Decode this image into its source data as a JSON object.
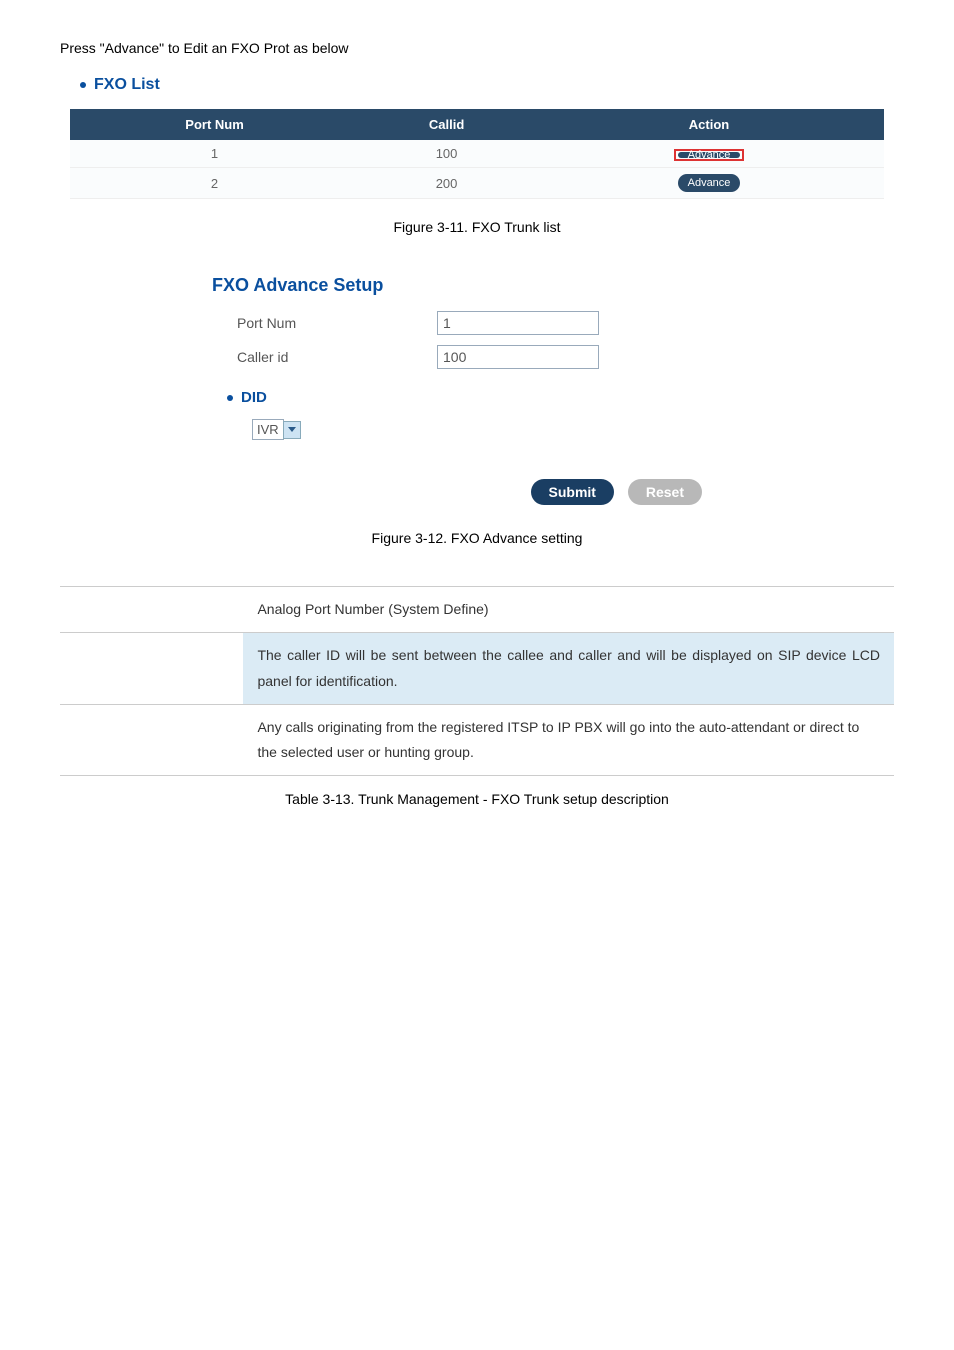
{
  "intro": "Press \"Advance\" to Edit an FXO Prot as below",
  "fxo_list": {
    "title": "FXO List",
    "headers": [
      "Port Num",
      "Callid",
      "Action"
    ],
    "rows": [
      {
        "port": "1",
        "callid": "100",
        "action": "Advance",
        "highlighted": true
      },
      {
        "port": "2",
        "callid": "200",
        "action": "Advance",
        "highlighted": false
      }
    ]
  },
  "caption1": "Figure 3-11. FXO Trunk list",
  "setup": {
    "title": "FXO Advance Setup",
    "port_num_label": "Port Num",
    "port_num_value": "1",
    "caller_id_label": "Caller id",
    "caller_id_value": "100",
    "did_title": "DID",
    "did_option": "IVR",
    "submit": "Submit",
    "reset": "Reset"
  },
  "caption2": "Figure 3-12. FXO Advance setting",
  "desc": {
    "rows": [
      {
        "left": "",
        "right": "Analog Port Number (System Define)",
        "class": ""
      },
      {
        "left": "",
        "right": "The caller ID will be sent between the callee and caller and will be displayed on SIP device LCD panel for identification.",
        "class": "row-blue"
      },
      {
        "left": "",
        "right": "Any calls originating from the registered ITSP to IP PBX will go into the auto-attendant or direct to the selected user or hunting group.",
        "class": ""
      }
    ]
  },
  "caption3": "Table 3-13. Trunk Management - FXO Trunk setup description"
}
